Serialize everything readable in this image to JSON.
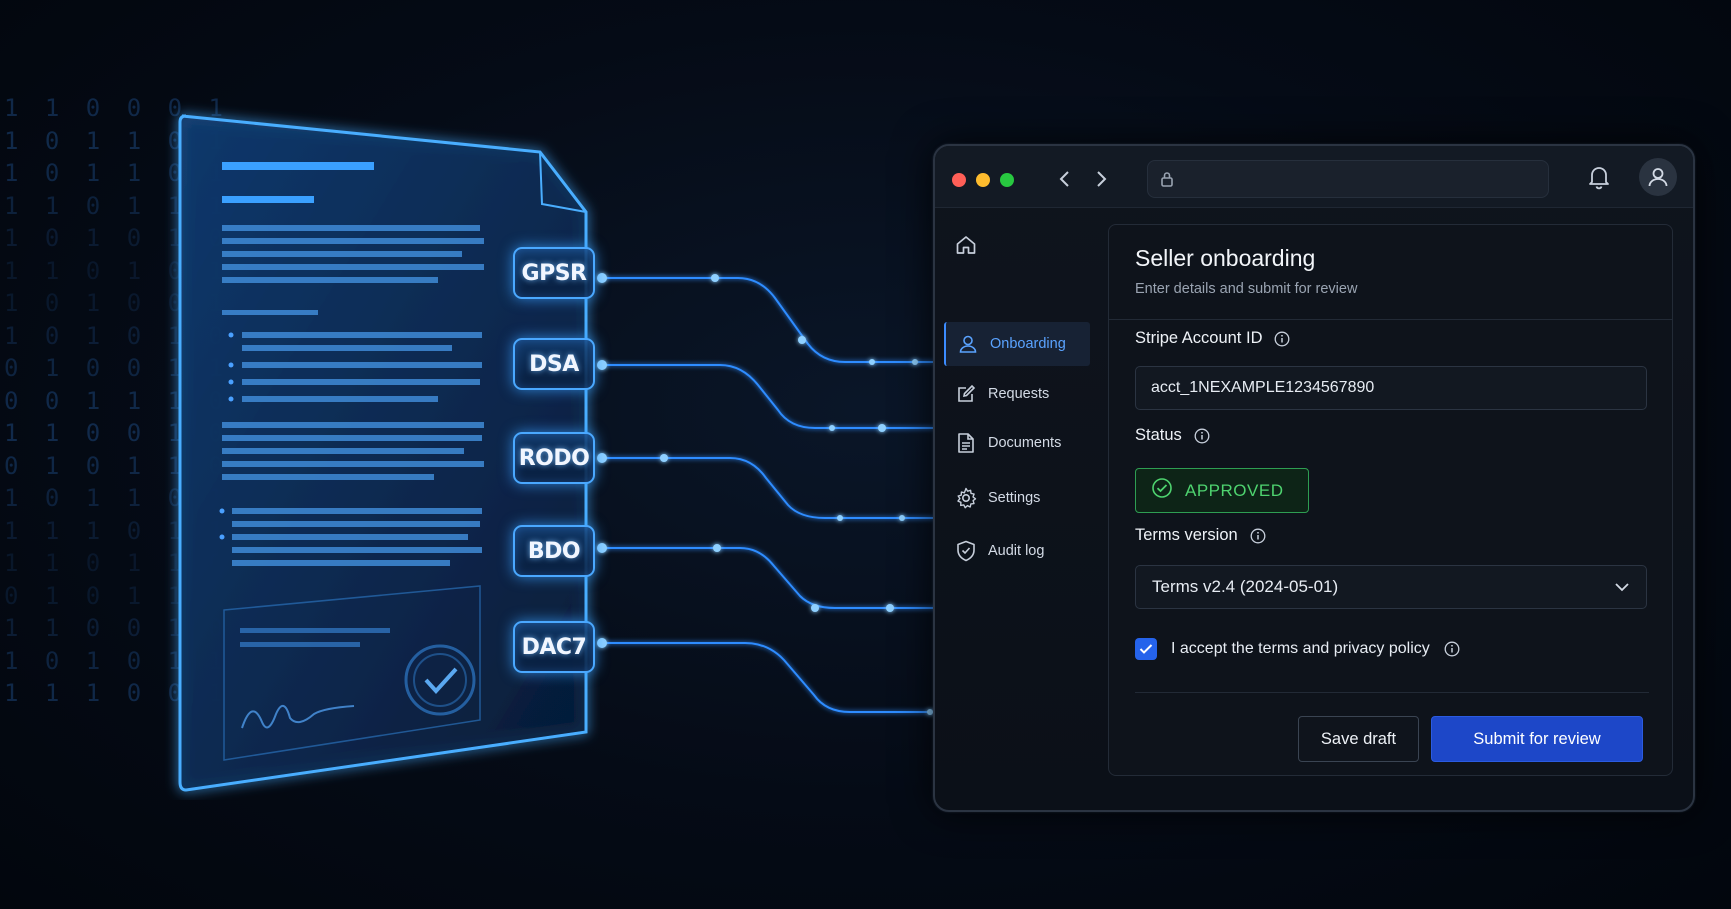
{
  "binary": {
    "rows": [
      "1 1 0 0 0 1",
      "1 0 1 1 0 1",
      "1 0 1 1 0 1",
      "1 1 0 1 1 1",
      "1 0 1 0 1 0",
      "1 1 0 1 0 1",
      "1 0 1 0 0 1",
      "1 0 1 0 1 0",
      "0 1 0 0 1 1",
      "0 0 1 1 1 0",
      "1 1 0 0 1 0",
      "0 1 0 1 1 0",
      "1 0 1 1 0 1",
      "1 1 1 0 1 1",
      "1 1 0 1 1 0",
      "0 1 0 1 1 1",
      "1 1 0 0 1 0",
      "1 0 1 0 1 1",
      "1 1 1 0 0 1"
    ]
  },
  "tags": [
    "GPSR",
    "DSA",
    "RODO",
    "BDO",
    "DAC7"
  ],
  "window": {
    "address": ""
  },
  "sidebar": {
    "items": [
      {
        "label": "Onboarding",
        "icon": "user-icon",
        "active": true
      },
      {
        "label": "Requests",
        "icon": "edit-icon",
        "active": false
      },
      {
        "label": "Documents",
        "icon": "document-icon",
        "active": false
      },
      {
        "label": "Settings",
        "icon": "gear-icon",
        "active": false
      },
      {
        "label": "Audit log",
        "icon": "shield-check-icon",
        "active": false
      }
    ]
  },
  "form": {
    "title": "Seller onboarding",
    "subtitle": "Enter details and submit for review",
    "stripe_label": "Stripe Account ID",
    "stripe_value": "acct_1NEXAMPLE1234567890",
    "status_label": "Status",
    "status_value": "APPROVED",
    "terms_label": "Terms version",
    "terms_value": "Terms v2.4 (2024-05-01)",
    "accept_label": "I accept the terms and privacy policy",
    "accept_checked": true,
    "save_label": "Save draft",
    "submit_label": "Submit for review"
  },
  "colors": {
    "accent": "#2563eb",
    "active_nav": "#5aa3ff",
    "status_green": "#4ed36f",
    "glow": "#4aa8ff"
  }
}
